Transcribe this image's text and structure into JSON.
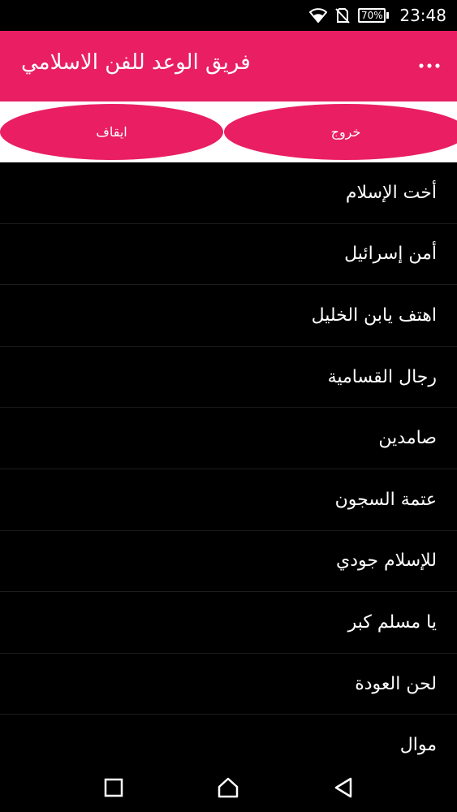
{
  "status_bar": {
    "battery_percent": "70%",
    "battery_level": 0.7,
    "time": "23:48",
    "icons": [
      "wifi-icon",
      "no-sim-icon",
      "battery-icon"
    ]
  },
  "app_bar": {
    "title": "فريق الوعد للفن الاسلامي",
    "menu_icon": "overflow-menu-icon"
  },
  "controls": {
    "stop_label": "ايقاف",
    "exit_label": "خروج"
  },
  "songs": [
    {
      "label": "أخت الإسلام"
    },
    {
      "label": "أمن إسرائيل"
    },
    {
      "label": "اهتف يابن الخليل"
    },
    {
      "label": "رجال القسامية"
    },
    {
      "label": "صامدين"
    },
    {
      "label": "عتمة السجون"
    },
    {
      "label": "للإسلام جودي"
    },
    {
      "label": "يا مسلم كبر"
    },
    {
      "label": "لحن العودة"
    },
    {
      "label": "موال"
    }
  ],
  "nav_bar": {
    "icons": [
      "recent-apps-icon",
      "home-icon",
      "back-icon"
    ]
  },
  "colors": {
    "accent": "#e91e63",
    "background": "#000000",
    "controls_background": "#ffffff"
  }
}
